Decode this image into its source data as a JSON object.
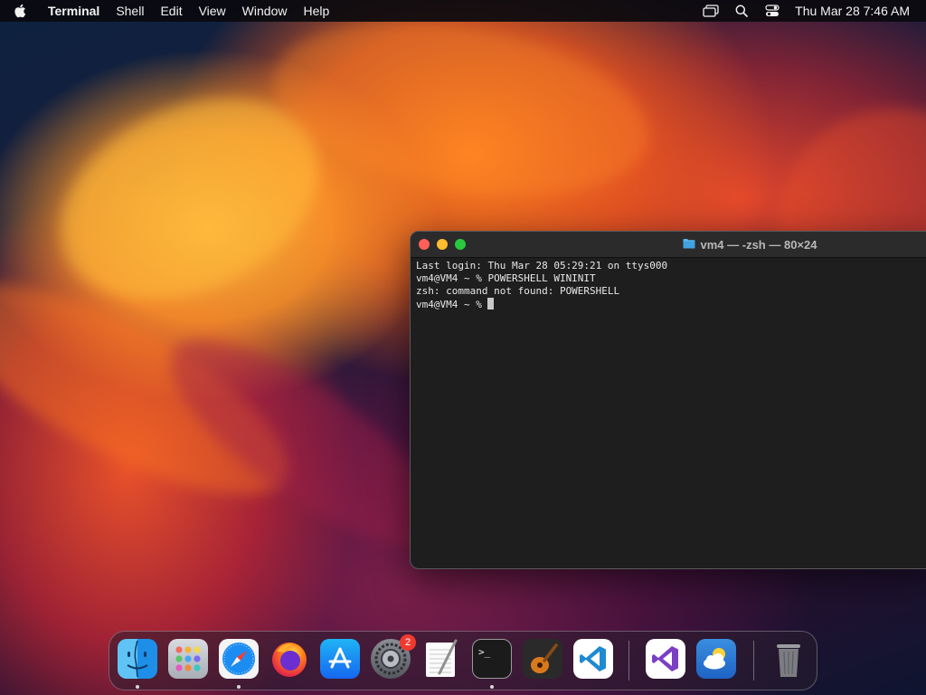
{
  "menubar": {
    "apple_icon": "apple-logo-icon",
    "app_name": "Terminal",
    "menus": [
      "Shell",
      "Edit",
      "View",
      "Window",
      "Help"
    ],
    "status_icons": [
      "screen-mirroring-icon",
      "spotlight-search-icon",
      "control-center-icon"
    ],
    "clock": "Thu Mar 28  7:46 AM"
  },
  "terminal": {
    "title": "vm4 — -zsh — 80×24",
    "title_icon": "folder-icon",
    "lines": [
      "Last login: Thu Mar 28 05:29:21 on ttys000",
      "vm4@VM4 ~ % POWERSHELL WININIT",
      "zsh: command not found: POWERSHELL",
      "vm4@VM4 ~ % "
    ]
  },
  "dock": {
    "apps": [
      {
        "name": "Finder",
        "icon": "finder-icon",
        "running": true
      },
      {
        "name": "Launchpad",
        "icon": "launchpad-icon",
        "running": false
      },
      {
        "name": "Safari",
        "icon": "safari-icon",
        "running": true
      },
      {
        "name": "Firefox",
        "icon": "firefox-icon",
        "running": false
      },
      {
        "name": "App Store",
        "icon": "app-store-icon",
        "running": false
      },
      {
        "name": "System Settings",
        "icon": "system-settings-icon",
        "running": false,
        "badge": "2"
      },
      {
        "name": "TextEdit",
        "icon": "textedit-icon",
        "running": false
      },
      {
        "name": "Terminal",
        "icon": "terminal-icon",
        "running": true
      },
      {
        "name": "GarageBand",
        "icon": "garageband-icon",
        "running": false
      },
      {
        "name": "Visual Studio Code",
        "icon": "vscode-icon",
        "running": false
      },
      {
        "name": "Visual Studio",
        "icon": "visual-studio-icon",
        "running": false
      },
      {
        "name": "Weather",
        "icon": "weather-icon",
        "running": false
      },
      {
        "name": "Trash",
        "icon": "trash-icon",
        "running": false
      }
    ]
  }
}
